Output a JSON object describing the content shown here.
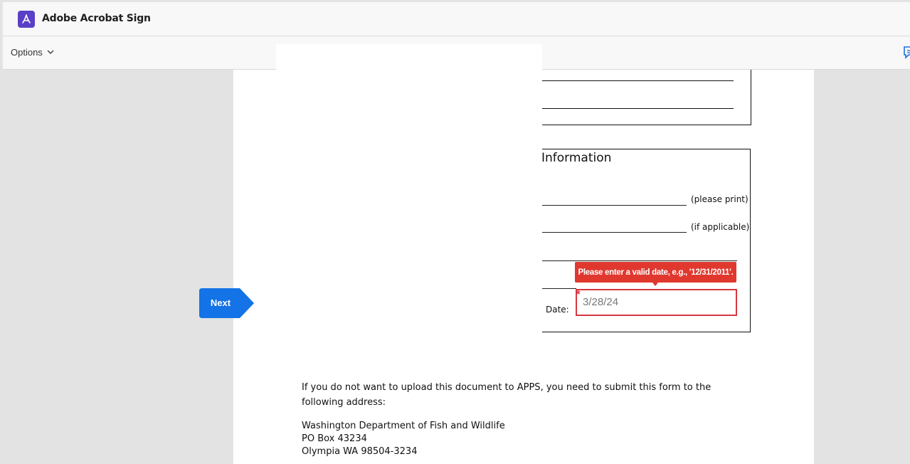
{
  "app": {
    "title": "Adobe Acrobat Sign"
  },
  "toolbar": {
    "options_label": "Options"
  },
  "form": {
    "section_title": "Information",
    "please_print_label": "(please print)",
    "if_applicable_label": "(if applicable)",
    "date_label": "Date:",
    "date_value": "3/28/24",
    "required_marker": "*",
    "error_tooltip": "Please enter a valid date, e.g., '12/31/2011'."
  },
  "navigation": {
    "next_label": "Next"
  },
  "document": {
    "paragraph": "If you do not want to upload this document to APPS, you need to submit this form to the following address:",
    "address_line_1": "Washington Department of Fish and Wildlife",
    "address_line_2": "PO Box 43234",
    "address_line_3": "Olympia WA 98504-3234"
  },
  "colors": {
    "brand": "#5a3fc7",
    "error": "#e0382f",
    "next_button": "#1473e6"
  }
}
